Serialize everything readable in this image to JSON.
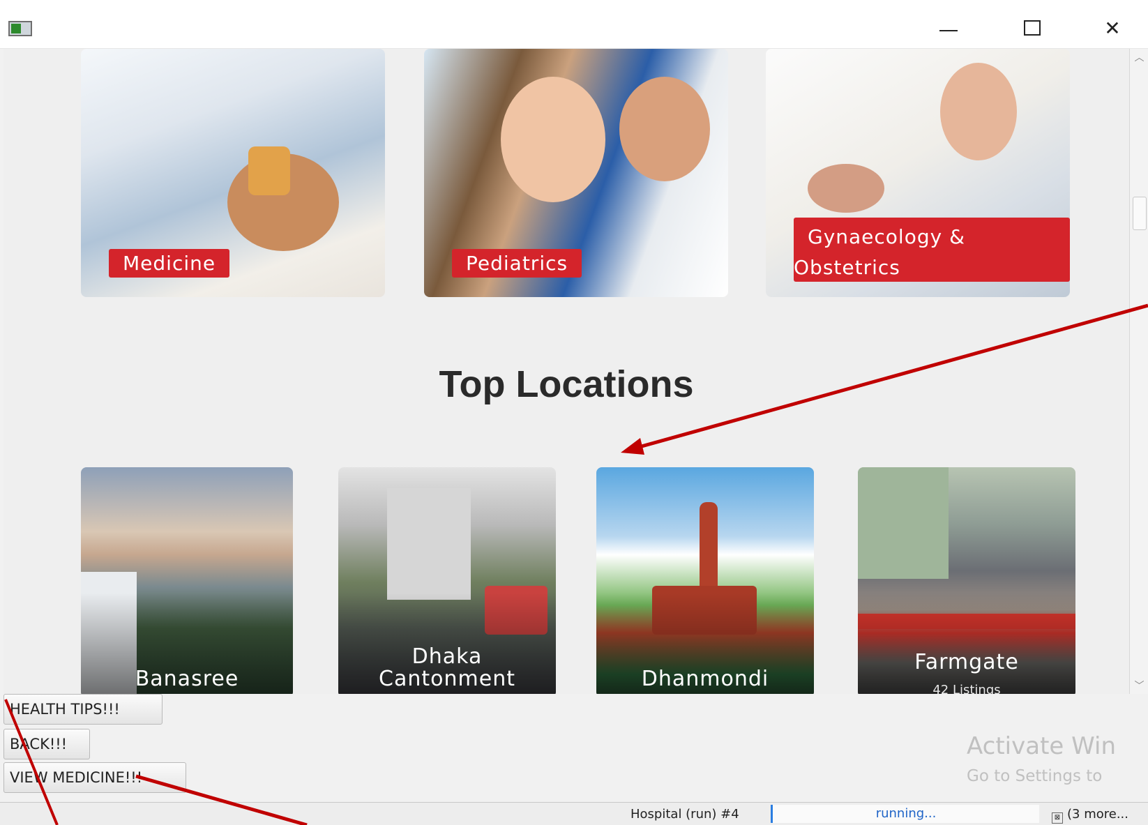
{
  "window": {
    "controls": {
      "minimize_icon": "minimize-icon",
      "maximize_icon": "maximize-icon",
      "close_icon": "close-icon",
      "close_glyph": "✕"
    }
  },
  "specialties": [
    {
      "label": "Medicine"
    },
    {
      "label": "Pediatrics"
    },
    {
      "label": "Gynaecology &\nObstetrics",
      "label_line1": "Gynaecology &",
      "label_line2": "Obstetrics"
    }
  ],
  "section_title": "Top Locations",
  "locations": [
    {
      "name": "Banasree"
    },
    {
      "name_line1": "Dhaka",
      "name_line2": "Cantonment"
    },
    {
      "name": "Dhanmondi"
    },
    {
      "name": "Farmgate",
      "listings": "42 Listings"
    }
  ],
  "buttons": {
    "health_tips": "HEALTH  TIPS!!!",
    "back": "BACK!!!",
    "view_medicine": "VIEW MEDICINE!!!"
  },
  "watermark": {
    "title": "Activate Win",
    "subtitle": "Go to Settings to"
  },
  "statusbar": {
    "task": "Hospital (run) #4",
    "progress_text": "running...",
    "more": "(3 more..."
  },
  "colors": {
    "accent_red": "#d4242b",
    "annotation_red": "#c00000",
    "progress_blue": "#2a7de1"
  },
  "scrollbar": {
    "up_icon": "chevron-up-icon",
    "down_icon": "chevron-down-icon"
  }
}
